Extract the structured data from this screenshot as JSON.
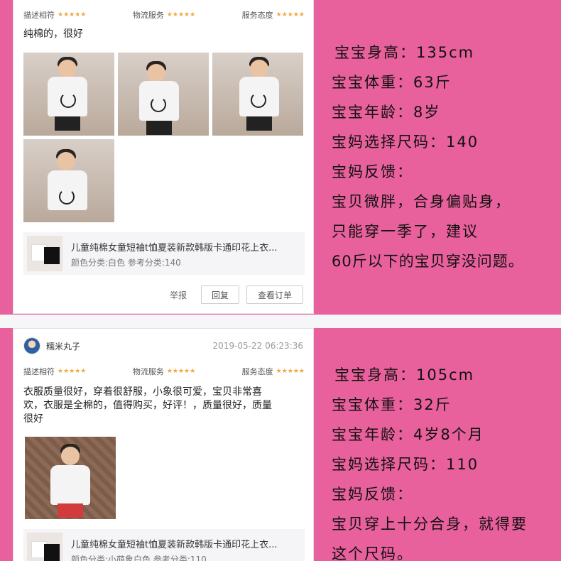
{
  "review1": {
    "ratings": [
      {
        "label": "描述相符",
        "stars": "★★★★★"
      },
      {
        "label": "物流服务",
        "stars": "★★★★★"
      },
      {
        "label": "服务态度",
        "stars": "★★★★★"
      }
    ],
    "text": "纯棉的，很好",
    "product": {
      "title": "儿童纯棉女童短袖t恤夏装新款韩版卡通印花上衣...",
      "variant": "颜色分类:白色  参考分类:140"
    },
    "actions": {
      "report": "举报",
      "reply": "回复",
      "view_order": "查看订单"
    }
  },
  "panel1": {
    "lines": [
      "宝宝身高：135cm",
      "宝宝体重：63斤",
      "宝宝年龄：8岁",
      "宝妈选择尺码：140",
      "宝妈反馈：",
      "宝贝微胖，合身偏贴身，",
      "只能穿一季了，建议",
      "60斤以下的宝贝穿没问题。"
    ]
  },
  "review2": {
    "username": "糯米丸子",
    "timestamp": "2019-05-22 06:23:36",
    "ratings": [
      {
        "label": "描述相符",
        "stars": "★★★★★"
      },
      {
        "label": "物流服务",
        "stars": "★★★★★"
      },
      {
        "label": "服务态度",
        "stars": "★★★★★"
      }
    ],
    "text_lines": [
      "衣服质量很好，穿着很舒服，小象很可爱，宝贝非常喜",
      "欢，衣服是全棉的，值得购买，好评！，质量很好，质量",
      "很好"
    ],
    "product": {
      "title": "儿童纯棉女童短袖t恤夏装新款韩版卡通印花上衣...",
      "variant": "颜色分类:小萌象白色  参考分类:110"
    }
  },
  "panel2": {
    "lines": [
      "宝宝身高：105cm",
      "宝宝体重：32斤",
      "宝宝年龄：4岁8个月",
      "宝妈选择尺码：110",
      "宝妈反馈：",
      "宝贝穿上十分合身，就得要",
      "这个尺码。"
    ]
  },
  "colors": {
    "accent_pink": "#e8609c",
    "star": "#f3a53b"
  }
}
